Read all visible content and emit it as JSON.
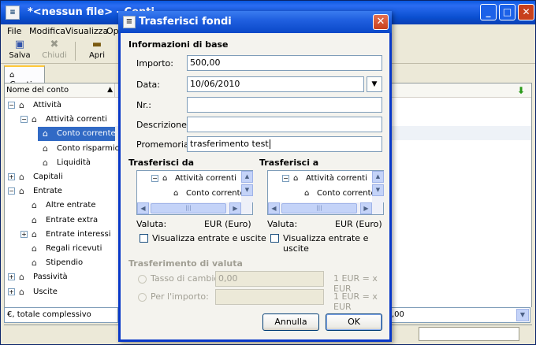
{
  "main_window": {
    "title": "*<nessun file> - Conti",
    "menu": [
      "File",
      "Modifica",
      "Visualizza",
      "Ope"
    ],
    "toolbar": {
      "save_label": "Salva",
      "close_label": "Chiudi",
      "open_label": "Apri"
    },
    "tab_label": "Conti",
    "tree_header": "Nome del conto",
    "tree_items": [
      {
        "label": "Attività",
        "indent": 0,
        "expander": "−"
      },
      {
        "label": "Attività correnti",
        "indent": 1,
        "expander": "−"
      },
      {
        "label": "Conto corrente",
        "indent": 2,
        "expander": "",
        "selected": true
      },
      {
        "label": "Conto risparmio",
        "indent": 2,
        "expander": ""
      },
      {
        "label": "Liquidità",
        "indent": 2,
        "expander": ""
      },
      {
        "label": "Capitali",
        "indent": 0,
        "expander": "+"
      },
      {
        "label": "Entrate",
        "indent": 0,
        "expander": "−"
      },
      {
        "label": "Altre entrate",
        "indent": 1,
        "expander": ""
      },
      {
        "label": "Entrate extra",
        "indent": 1,
        "expander": ""
      },
      {
        "label": "Entrate interessi",
        "indent": 1,
        "expander": "+"
      },
      {
        "label": "Regali ricevuti",
        "indent": 1,
        "expander": ""
      },
      {
        "label": "Stipendio",
        "indent": 1,
        "expander": ""
      },
      {
        "label": "Passività",
        "indent": 0,
        "expander": "+"
      },
      {
        "label": "Uscite",
        "indent": 0,
        "expander": "+"
      }
    ],
    "bottom_combo_left": "€, totale complessivo",
    "bottom_combo_right": ",00"
  },
  "dialog": {
    "title": "Trasferisci fondi",
    "basic_info_header": "Informazioni di base",
    "amount_label": "Importo:",
    "amount_value": "500,00",
    "date_label": "Data:",
    "date_value": "10/06/2010",
    "num_label": "Nr.:",
    "num_value": "",
    "description_label": "Descrizione:",
    "description_value": "",
    "memo_label": "Promemoria:",
    "memo_value": "trasferimento test",
    "from_header": "Trasferisci da",
    "to_header": "Trasferisci a",
    "from_tree": [
      "Attività correnti",
      "Conto corrente"
    ],
    "to_tree": [
      "Attività correnti",
      "Conto corrente"
    ],
    "currency_label": "Valuta:",
    "from_currency": "EUR (Euro)",
    "to_currency": "EUR (Euro)",
    "show_income_expense": "Visualizza entrate e uscite",
    "currency_transfer_header": "Trasferimento di valuta",
    "exchange_rate_label": "Tasso di cambio:",
    "exchange_rate_value": "0,00",
    "exchange_rate_unit": "1 EUR = x EUR",
    "amount_radio_label": "Per l'importo:",
    "amount_radio_value": "",
    "amount_radio_unit": "1 EUR = x EUR",
    "cancel_button": "Annulla",
    "ok_button": "OK"
  }
}
